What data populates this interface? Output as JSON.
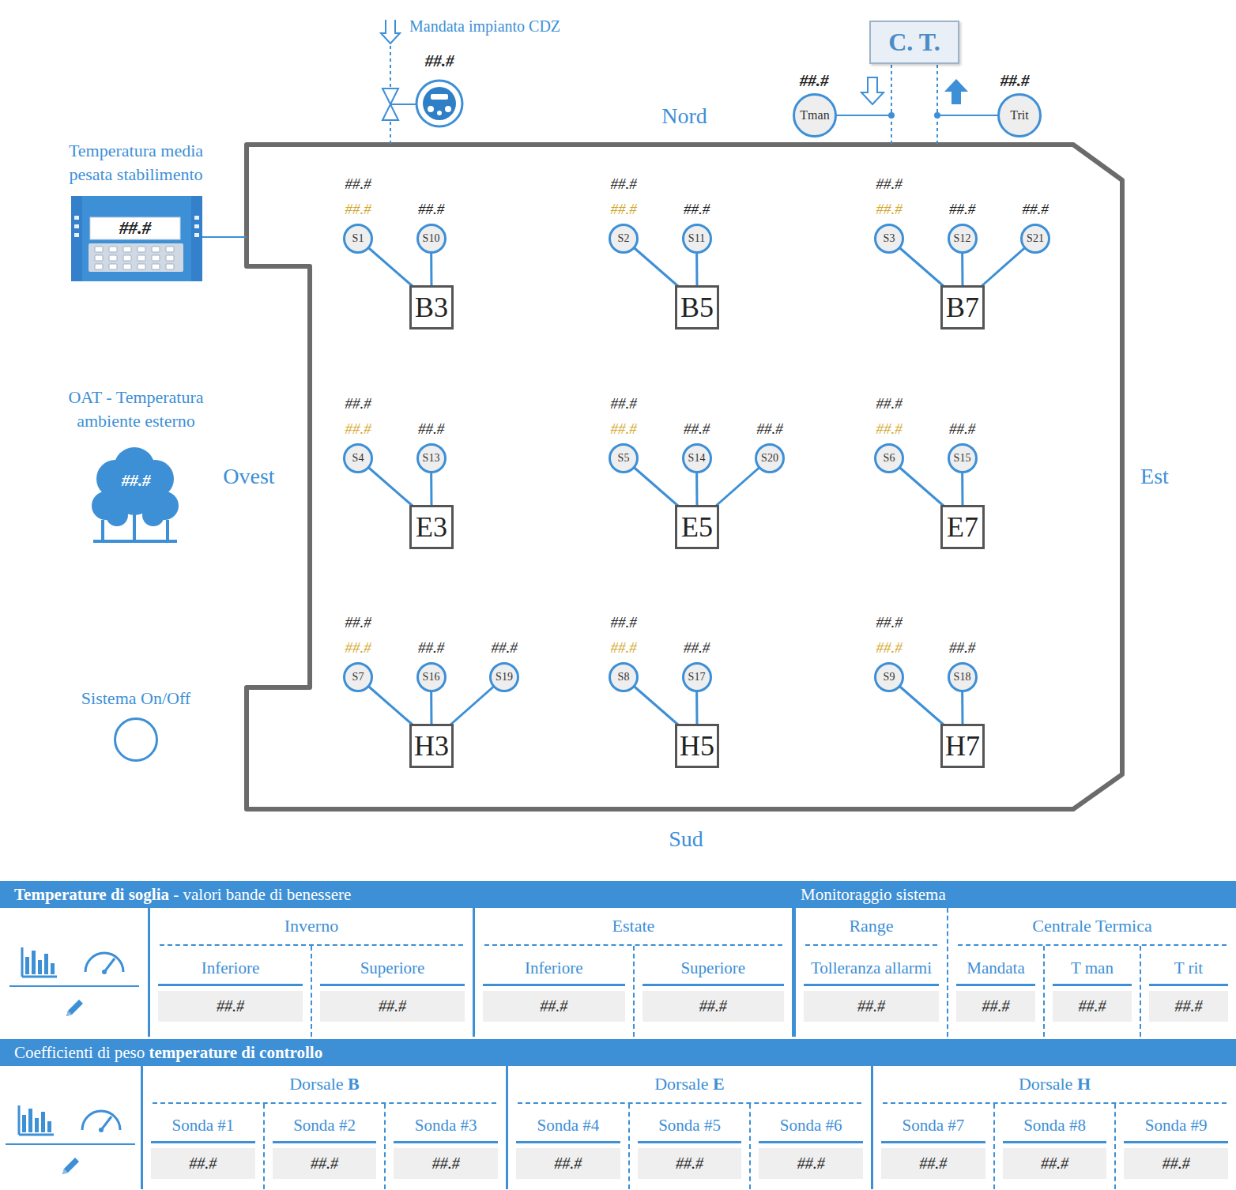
{
  "diagram": {
    "compass": {
      "north": "Nord",
      "south": "Sud",
      "west": "Ovest",
      "east": "Est"
    },
    "supply": {
      "label": "Mandata impianto CDZ",
      "value": "##.#"
    },
    "central_plant": {
      "label": "C. T.",
      "flow": {
        "label": "Tman",
        "value": "##.#"
      },
      "return": {
        "label": "Trit",
        "value": "##.#"
      }
    },
    "weighted_avg": {
      "label_lines": [
        "Temperatura media",
        "pesata stabilimento"
      ],
      "value": "##.#"
    },
    "oat": {
      "label_lines": [
        "OAT - Temperatura",
        "ambiente esterno"
      ],
      "value": "##.#"
    },
    "system": {
      "label": "Sistema On/Off",
      "on": false
    },
    "groups": [
      {
        "name": "B3",
        "reading": "##.#",
        "probes": [
          {
            "name": "S1",
            "value": "##.#",
            "kind": "control"
          },
          {
            "name": "S10",
            "value": "##.#",
            "kind": "zone"
          }
        ]
      },
      {
        "name": "B5",
        "reading": "##.#",
        "probes": [
          {
            "name": "S2",
            "value": "##.#",
            "kind": "control"
          },
          {
            "name": "S11",
            "value": "##.#",
            "kind": "zone"
          }
        ]
      },
      {
        "name": "B7",
        "reading": "##.#",
        "probes": [
          {
            "name": "S3",
            "value": "##.#",
            "kind": "control"
          },
          {
            "name": "S12",
            "value": "##.#",
            "kind": "zone"
          },
          {
            "name": "S21",
            "value": "##.#",
            "kind": "zone"
          }
        ]
      },
      {
        "name": "E3",
        "reading": "##.#",
        "probes": [
          {
            "name": "S4",
            "value": "##.#",
            "kind": "control"
          },
          {
            "name": "S13",
            "value": "##.#",
            "kind": "zone"
          }
        ]
      },
      {
        "name": "E5",
        "reading": "##.#",
        "probes": [
          {
            "name": "S5",
            "value": "##.#",
            "kind": "control"
          },
          {
            "name": "S14",
            "value": "##.#",
            "kind": "zone"
          },
          {
            "name": "S20",
            "value": "##.#",
            "kind": "zone"
          }
        ]
      },
      {
        "name": "E7",
        "reading": "##.#",
        "probes": [
          {
            "name": "S6",
            "value": "##.#",
            "kind": "control"
          },
          {
            "name": "S15",
            "value": "##.#",
            "kind": "zone"
          }
        ]
      },
      {
        "name": "H3",
        "reading": "##.#",
        "probes": [
          {
            "name": "S7",
            "value": "##.#",
            "kind": "control"
          },
          {
            "name": "S16",
            "value": "##.#",
            "kind": "zone"
          },
          {
            "name": "S19",
            "value": "##.#",
            "kind": "zone"
          }
        ]
      },
      {
        "name": "H5",
        "reading": "##.#",
        "probes": [
          {
            "name": "S8",
            "value": "##.#",
            "kind": "control"
          },
          {
            "name": "S17",
            "value": "##.#",
            "kind": "zone"
          }
        ]
      },
      {
        "name": "H7",
        "reading": "##.#",
        "probes": [
          {
            "name": "S9",
            "value": "##.#",
            "kind": "control"
          },
          {
            "name": "S18",
            "value": "##.#",
            "kind": "zone"
          }
        ]
      }
    ]
  },
  "thresholds": {
    "panels": [
      {
        "title": [
          {
            "text": "Temperature di soglia",
            "bold": true
          },
          {
            "text": "- valori bande di benessere",
            "bold": false
          }
        ],
        "groups": [
          {
            "title": [
              {
                "text": "Inverno",
                "bold": false
              }
            ],
            "fields": [
              {
                "label": "Inferiore",
                "value": "##.#"
              },
              {
                "label": "Superiore",
                "value": "##.#"
              }
            ]
          },
          {
            "title": [
              {
                "text": "Estate",
                "bold": false
              }
            ],
            "fields": [
              {
                "label": "Inferiore",
                "value": "##.#"
              },
              {
                "label": "Superiore",
                "value": "##.#"
              }
            ]
          }
        ]
      },
      {
        "title": [
          {
            "text": "Monitoraggio sistema",
            "bold": false
          }
        ],
        "groups": [
          {
            "title": [
              {
                "text": "Range",
                "bold": false
              }
            ],
            "fields": [
              {
                "label": "Tolleranza allarmi",
                "value": "##.#"
              }
            ]
          },
          {
            "title": [
              {
                "text": "Centrale Termica",
                "bold": false
              }
            ],
            "fields": [
              {
                "label": "Mandata",
                "value": "##.#"
              },
              {
                "label": "T man",
                "value": "##.#"
              },
              {
                "label": "T rit",
                "value": "##.#"
              }
            ]
          }
        ]
      }
    ]
  },
  "weights": {
    "title": [
      {
        "text": "Coefficienti di peso",
        "bold": false
      },
      {
        "text": "temperature di controllo",
        "bold": true
      }
    ],
    "groups": [
      {
        "title": [
          {
            "text": "Dorsale",
            "bold": false
          },
          {
            "text": "B",
            "bold": true
          }
        ],
        "fields": [
          {
            "label": "Sonda #1",
            "value": "##.#"
          },
          {
            "label": "Sonda #2",
            "value": "##.#"
          },
          {
            "label": "Sonda #3",
            "value": "##.#"
          }
        ]
      },
      {
        "title": [
          {
            "text": "Dorsale",
            "bold": false
          },
          {
            "text": "E",
            "bold": true
          }
        ],
        "fields": [
          {
            "label": "Sonda #4",
            "value": "##.#"
          },
          {
            "label": "Sonda #5",
            "value": "##.#"
          },
          {
            "label": "Sonda #6",
            "value": "##.#"
          }
        ]
      },
      {
        "title": [
          {
            "text": "Dorsale",
            "bold": false
          },
          {
            "text": "H",
            "bold": true
          }
        ],
        "fields": [
          {
            "label": "Sonda #7",
            "value": "##.#"
          },
          {
            "label": "Sonda #8",
            "value": "##.#"
          },
          {
            "label": "Sonda #9",
            "value": "##.#"
          }
        ]
      }
    ]
  }
}
